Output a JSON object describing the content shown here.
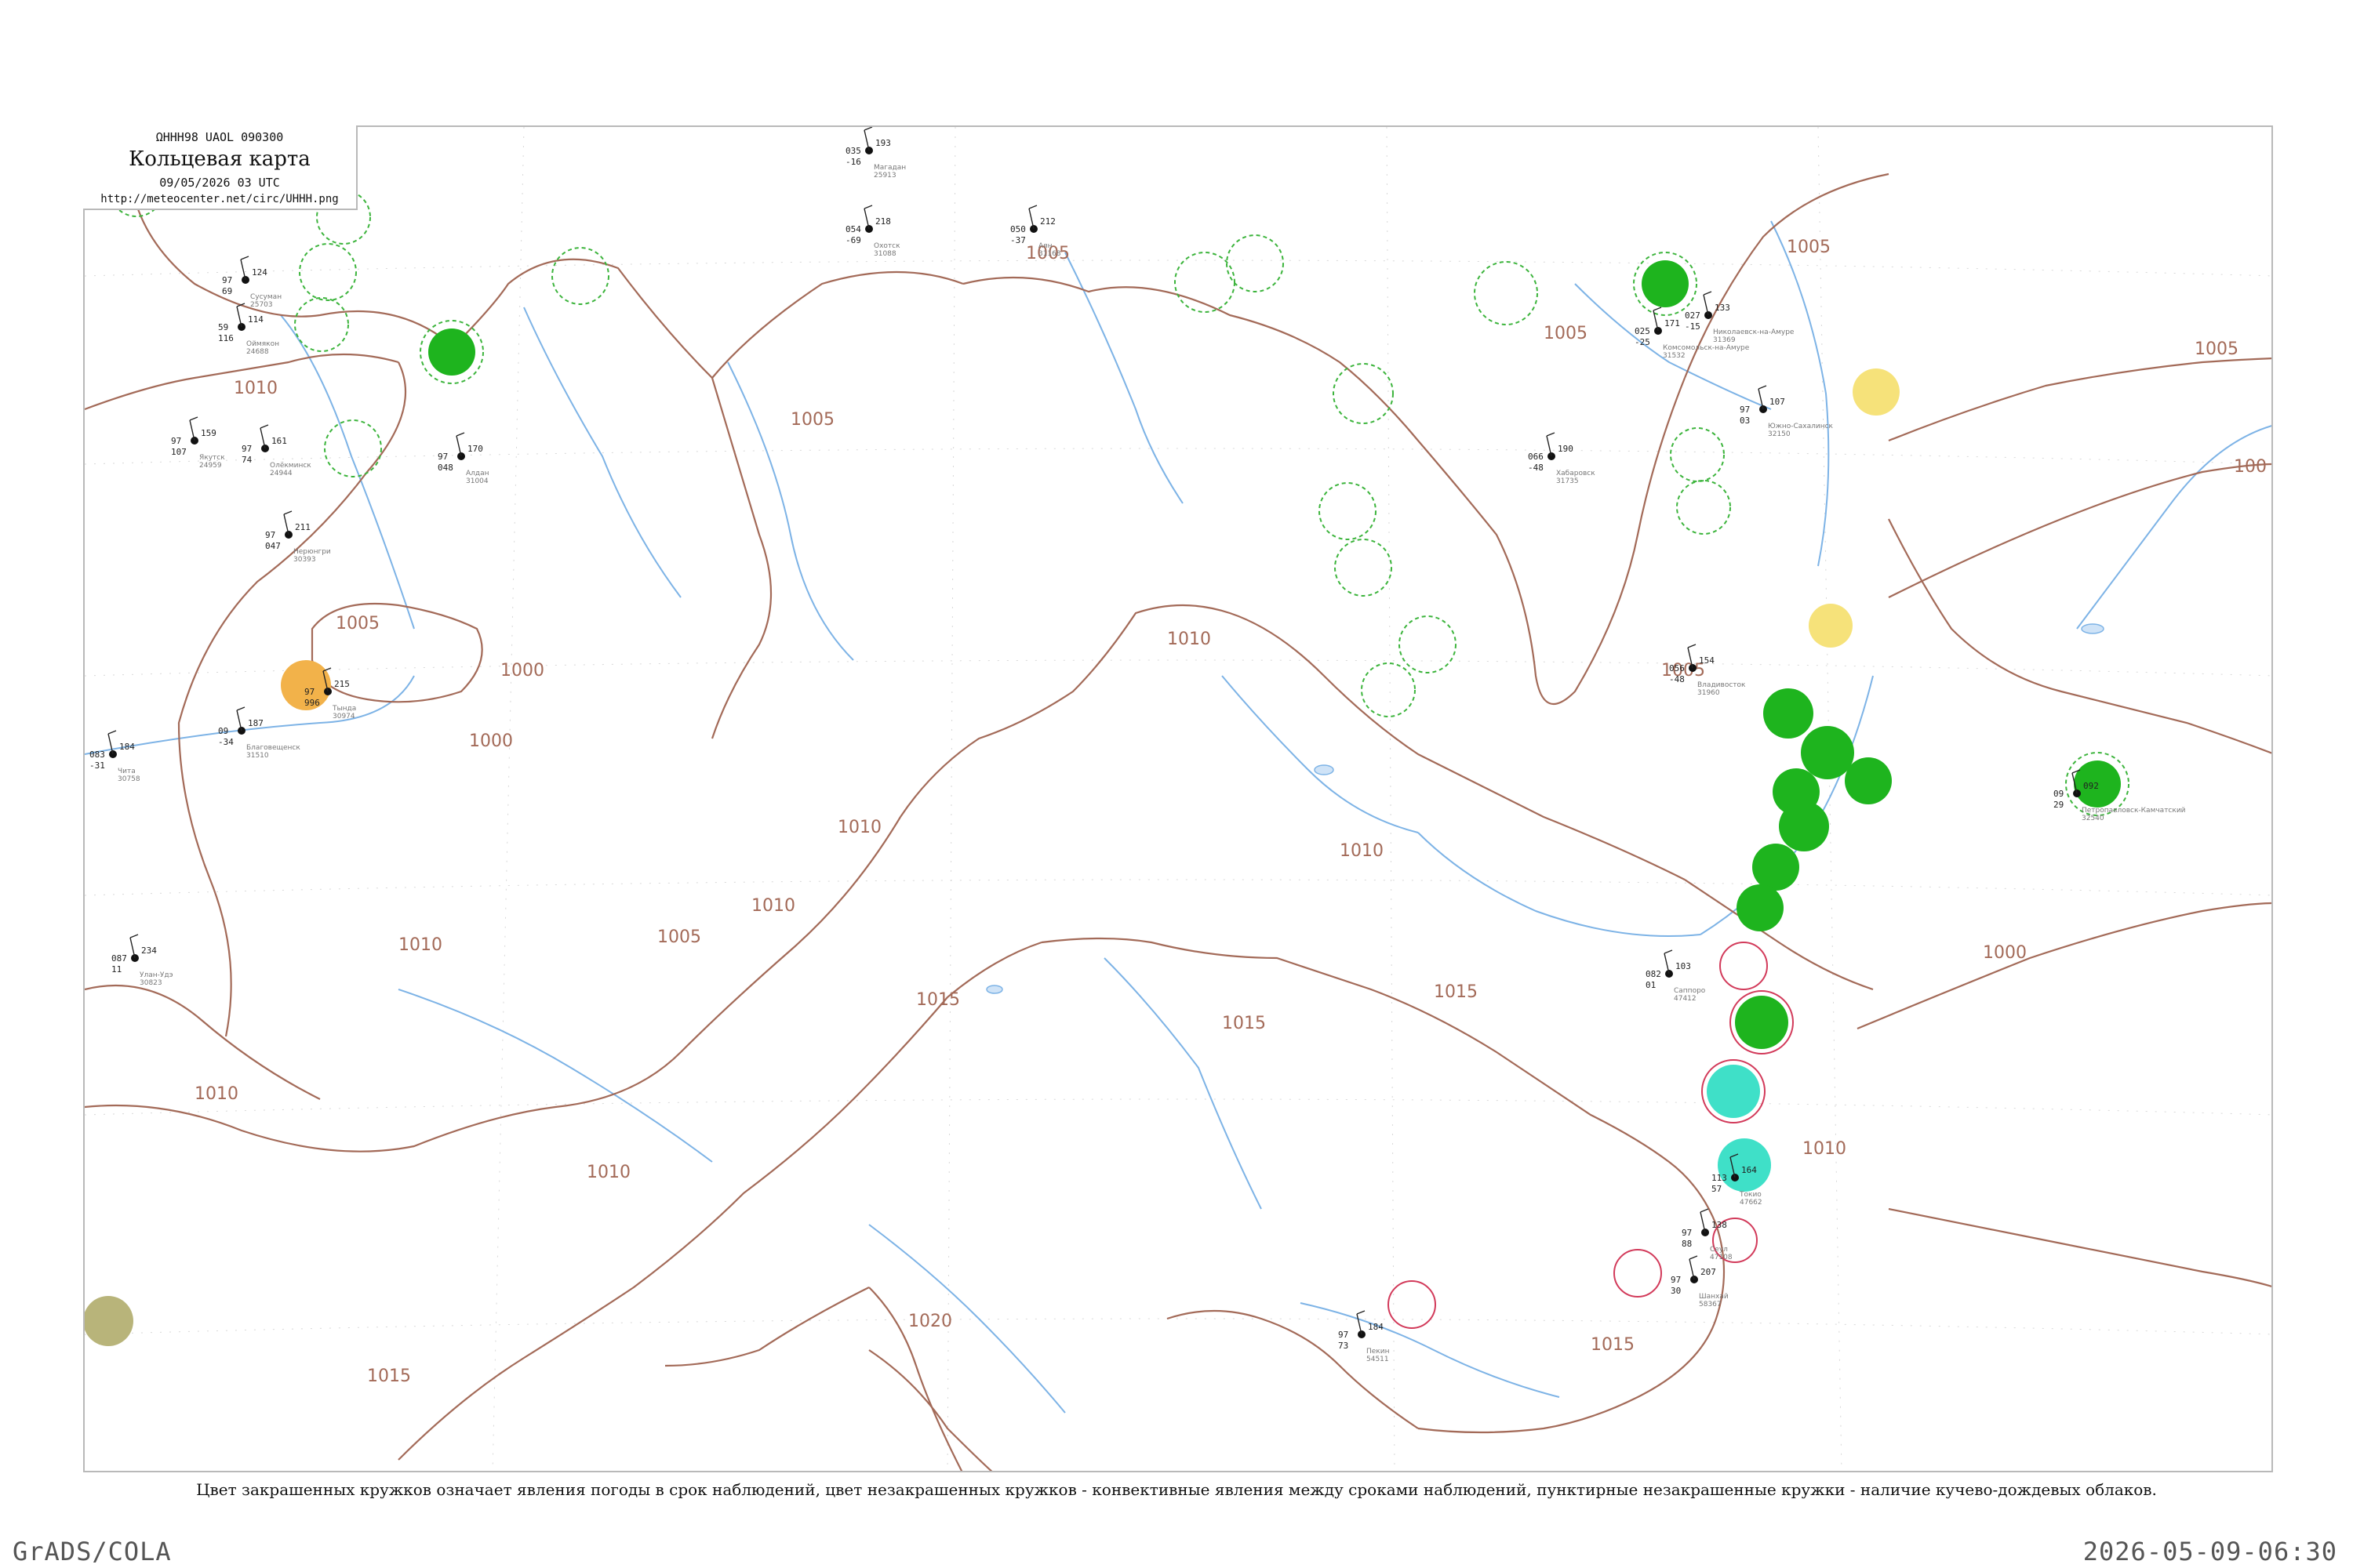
{
  "header": {
    "code": "ΩHHH98  UAOL  090300",
    "title": "Кольцевая карта",
    "time": "09/05/2026 03 UTC",
    "url": "http://meteocenter.net/circ/UHHH.png"
  },
  "isobar_labels": [
    "1005",
    "1010",
    "1005",
    "1010",
    "1000",
    "1005",
    "1010",
    "1015",
    "1010",
    "1015",
    "1020",
    "1015",
    "1010",
    "1005",
    "1005",
    "1000",
    "1010",
    "1005",
    "1005",
    "1010",
    "1015",
    "1010",
    "1010",
    "1005",
    "1015",
    "1000",
    "100"
  ],
  "legend": {
    "caption": "Цвет закрашенных кружков означает явления погоды в срок наблюдений, цвет незакрашенных кружков - конвективные явления между сроками наблюдений, пунктирные незакрашенные кружки - наличие кучево-дождевых облаков."
  },
  "colors": {
    "isobar": "#a36a58",
    "river": "#7db3e6",
    "rain_fill": "#1eb41e",
    "shower_fill": "#3fe0c8",
    "fog_fill": "#f6e27a",
    "haze_fill": "#f2b24a",
    "dust_fill": "#b8b47a",
    "cb_ring": "#3cb43c",
    "thunder_ring": "#d23a5a"
  },
  "stations": [
    {
      "name": "Сусуман",
      "id": "25703",
      "p": "124",
      "t": "97",
      "td": "69"
    },
    {
      "name": "Оймякон",
      "id": "24688",
      "p": "114",
      "t": "59",
      "td": "116"
    },
    {
      "name": "Якутск",
      "id": "24959",
      "p": "159",
      "t": "97",
      "td": "107"
    },
    {
      "name": "Олёкминск",
      "id": "24944",
      "p": "161",
      "t": "97",
      "td": "74"
    },
    {
      "name": "Алдан",
      "id": "31004",
      "p": "170",
      "t": "97",
      "td": "048"
    },
    {
      "name": "Нерюнгри",
      "id": "30393",
      "p": "211",
      "t": "97",
      "td": "047"
    },
    {
      "name": "Тында",
      "id": "30974",
      "p": "215",
      "t": "97",
      "td": "996"
    },
    {
      "name": "Чита",
      "id": "30758",
      "p": "184",
      "t": "083",
      "td": "-31"
    },
    {
      "name": "Улан-Удэ",
      "id": "30823",
      "p": "234",
      "t": "087",
      "td": "11"
    },
    {
      "name": "Благовещенск",
      "id": "31510",
      "p": "187",
      "t": "09",
      "td": "-34"
    },
    {
      "name": "Магадан",
      "id": "25913",
      "p": "193",
      "t": "035",
      "td": "-16"
    },
    {
      "name": "Охотск",
      "id": "31088",
      "p": "218",
      "t": "054",
      "td": "-69"
    },
    {
      "name": "Аян",
      "id": "31168",
      "p": "212",
      "t": "050",
      "td": "-37"
    },
    {
      "name": "Николаевск-на-Амуре",
      "id": "31369",
      "p": "133",
      "t": "027",
      "td": "-15"
    },
    {
      "name": "Хабаровск",
      "id": "31735",
      "p": "190",
      "t": "066",
      "td": "-48"
    },
    {
      "name": "Комсомольск-на-Амуре",
      "id": "31532",
      "p": "171",
      "t": "025",
      "td": "-25"
    },
    {
      "name": "Южно-Сахалинск",
      "id": "32150",
      "p": "107",
      "t": "97",
      "td": "03"
    },
    {
      "name": "Владивосток",
      "id": "31960",
      "p": "154",
      "t": "056",
      "td": "-48"
    },
    {
      "name": "Петропавловск-Камчатский",
      "id": "32540",
      "p": "092",
      "t": "09",
      "td": "29"
    },
    {
      "name": "Саппоро",
      "id": "47412",
      "p": "103",
      "t": "082",
      "td": "01"
    },
    {
      "name": "Пекин",
      "id": "54511",
      "p": "184",
      "t": "97",
      "td": "73"
    },
    {
      "name": "Шанхай",
      "id": "58367",
      "p": "207",
      "t": "97",
      "td": "30"
    },
    {
      "name": "Сеул",
      "id": "47108",
      "p": "138",
      "t": "97",
      "td": "88"
    },
    {
      "name": "Токио",
      "id": "47662",
      "p": "164",
      "t": "113",
      "td": "57"
    }
  ],
  "footer": {
    "left": "GrADS/COLA",
    "right": "2026-05-09-06:30"
  }
}
